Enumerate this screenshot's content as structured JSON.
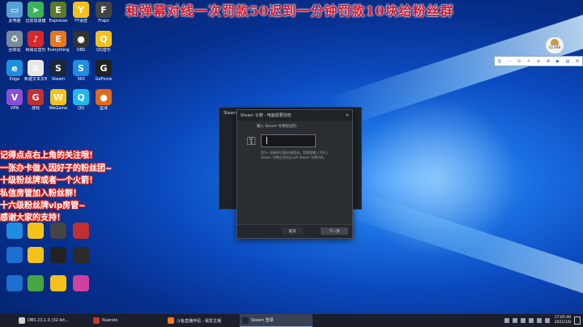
{
  "banner": "和弹幕对线一次罚款50迟到一分钟罚款10块给粉丝群",
  "desktop_icons": [
    {
      "label": "此电脑",
      "color": "#5aa0d8",
      "glyph": "▭"
    },
    {
      "label": "迅雷加速器",
      "color": "#3bb45a",
      "glyph": "➤"
    },
    {
      "label": "Expresso",
      "color": "#5c7a2a",
      "glyph": "E"
    },
    {
      "label": "YY语音",
      "color": "#f3c21a",
      "glyph": "Y"
    },
    {
      "label": "Fraps",
      "color": "#444444",
      "glyph": "F"
    },
    {
      "label": "回收站",
      "color": "#7a8a9a",
      "glyph": "♻"
    },
    {
      "label": "网易云音乐",
      "color": "#d6282b",
      "glyph": "♪"
    },
    {
      "label": "Everything",
      "color": "#e87722",
      "glyph": "E"
    },
    {
      "label": "OBS",
      "color": "#333333",
      "glyph": "●"
    },
    {
      "label": "QQ音乐",
      "color": "#f3c21a",
      "glyph": "Q"
    },
    {
      "label": "Edge",
      "color": "#1e8fe0",
      "glyph": "e"
    },
    {
      "label": "新建文本文档",
      "color": "#e8e8e8",
      "glyph": "≡"
    },
    {
      "label": "Steam",
      "color": "#1b2838",
      "glyph": "S"
    },
    {
      "label": "360",
      "color": "#1d8ee0",
      "glyph": "S"
    },
    {
      "label": "GeForce",
      "color": "#222222",
      "glyph": "G"
    },
    {
      "label": "VPN",
      "color": "#8a4fd8",
      "glyph": "V"
    },
    {
      "label": "游戏",
      "color": "#c03030",
      "glyph": "G"
    },
    {
      "label": "WeGame",
      "color": "#f3c21a",
      "glyph": "W"
    },
    {
      "label": "QQ",
      "color": "#1fb8ec",
      "glyph": "Q"
    },
    {
      "label": "篮球",
      "color": "#e06a1a",
      "glyph": "●"
    }
  ],
  "promo_lines": [
    "记得点点右上角的关注哦！",
    "一张办卡做入因好子的粉丝团~",
    "十级粉丝牌或者一个火箭！",
    "私信房管加入粉丝群！",
    "十六级粉丝牌vip房管~",
    "感谢大家的支持！"
  ],
  "steam_back_title": "Steam 库",
  "dialog": {
    "title": "Steam 令牌 - 电脑需要授权",
    "prompt": "输入 Steam 令牌验证码：",
    "code_value": "",
    "description": "您为一部新的设备申请登录。您需要输入手机上 Steam 令牌应用所显示的 Steam 令牌代码。",
    "back_label": "取消",
    "next_label": "下一步"
  },
  "qq_widget_number": "42,698",
  "toolstrip_items": [
    "云",
    "⋯",
    "⊙",
    "☼",
    "◎",
    "⊕",
    "▶",
    "▤",
    "✉"
  ],
  "taskbar": {
    "items": [
      {
        "label": "OBS 23.1.0 (32-bit...",
        "color": "#d0d0d0",
        "active": false
      },
      {
        "label": "Nuendo",
        "color": "#c0392b",
        "active": false
      },
      {
        "label": "斗鱼直播伴侣 - 我爱主播",
        "color": "#ff7a1a",
        "active": false
      },
      {
        "label": "Steam 登录",
        "color": "#1b2838",
        "active": true
      }
    ],
    "time": "17:05:40",
    "date": "2021/1/8"
  }
}
